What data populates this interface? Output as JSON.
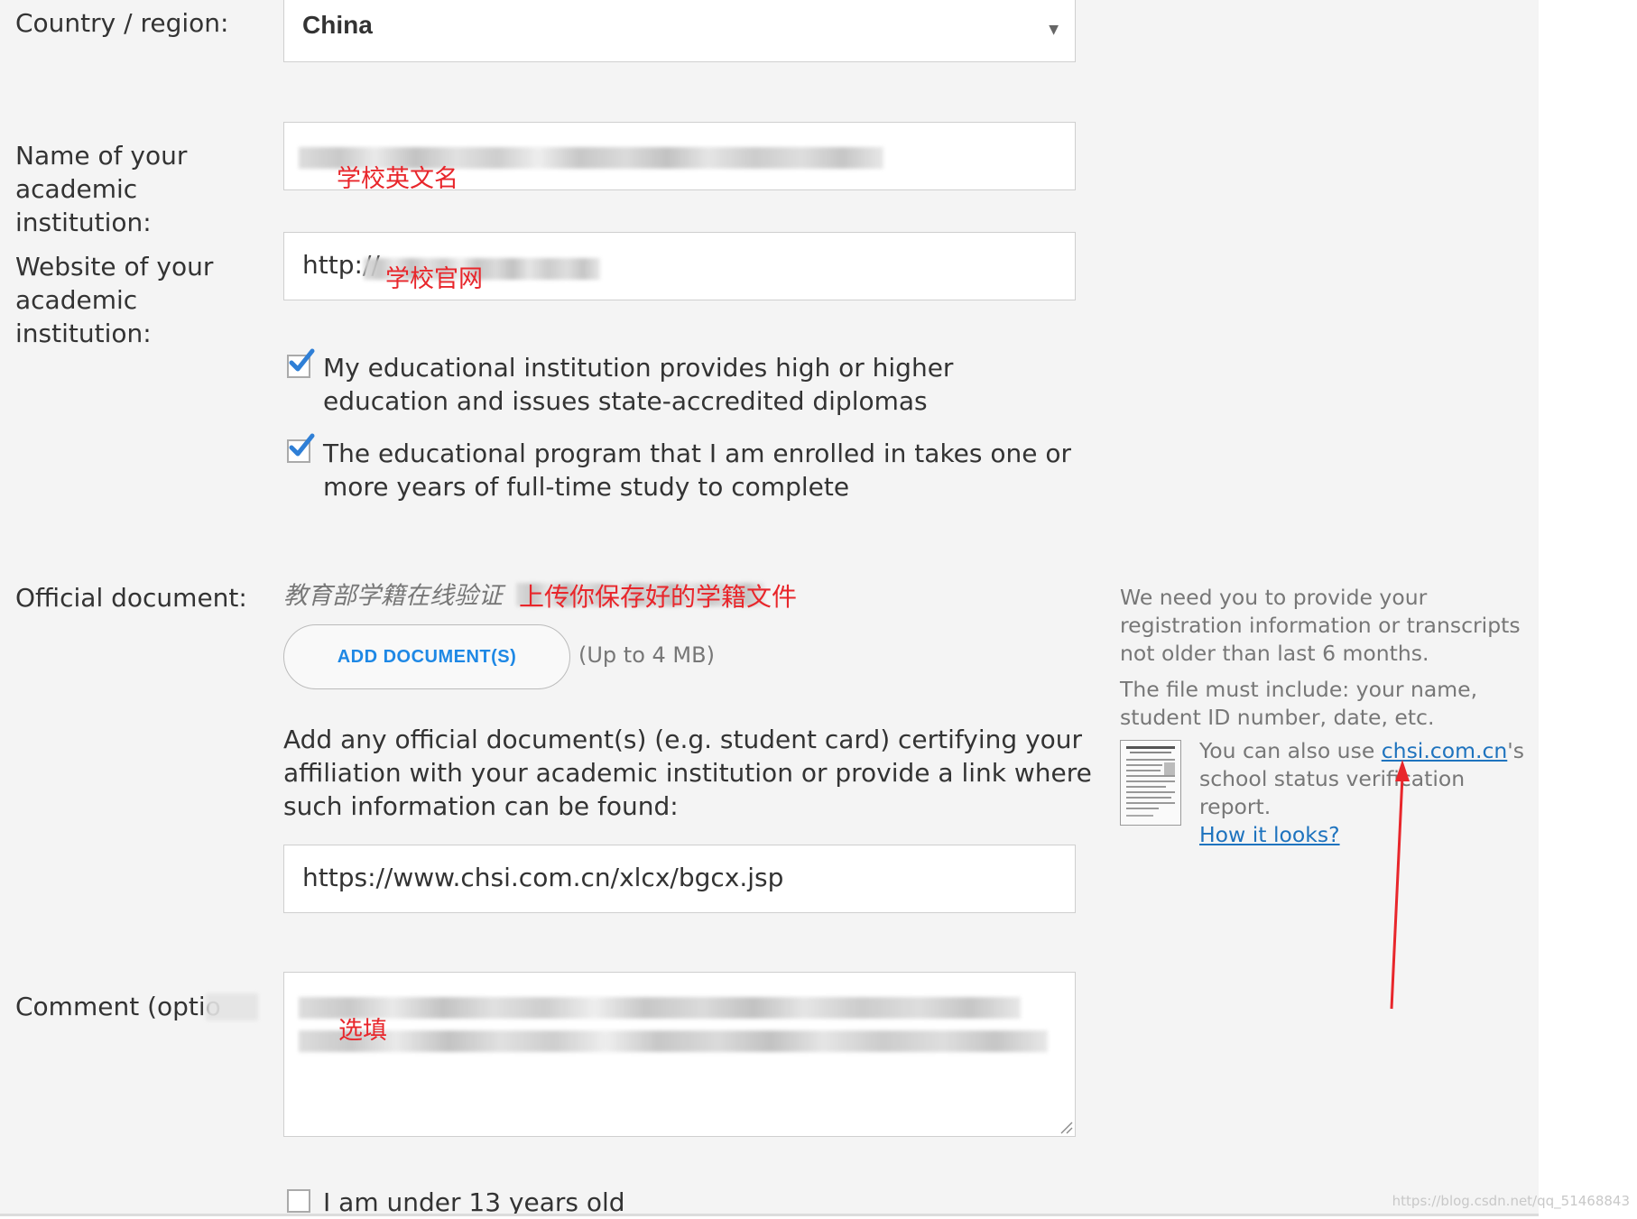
{
  "form": {
    "country_label": "Country / region:",
    "country_value": "China",
    "institution_name_label": "Name of your academic institution:",
    "institution_name_annotation": "学校英文名",
    "website_label": "Website of your academic institution:",
    "website_value": "http://",
    "website_annotation": "学校官网",
    "checkbox_1_label": "My educational institution provides high or higher education and issues state-accredited diplomas",
    "checkbox_1_checked": true,
    "checkbox_2_label": "The educational program that I am enrolled in takes one or more years of full-time study to complete",
    "checkbox_2_checked": true,
    "official_doc_label": "Official document:",
    "official_doc_filename": "教育部学籍在线验证",
    "official_doc_annotation": "上传你保存好的学籍文件",
    "add_document_button": "ADD DOCUMENT(S)",
    "size_hint": "(Up to 4 MB)",
    "link_instruction": "Add any official document(s) (e.g. student card) certifying your affiliation with your academic institution or provide a link where such information can be found:",
    "link_value": "https://www.chsi.com.cn/xlcx/bgcx.jsp",
    "comment_label": "Comment (optio",
    "comment_annotation": "选填",
    "under13_label": "I am under 13 years old",
    "under13_checked": false
  },
  "sidebar": {
    "para1": "We need you to provide your registration information or transcripts not older than last 6 months.",
    "para2": "The file must include: your name, student ID number, date, etc.",
    "note_prefix": "You can also use ",
    "note_link": "chsi.com.cn",
    "note_suffix_1": "'s",
    "note_suffix_2": "school status verification report.",
    "how_it_looks_link": "How it looks?"
  },
  "watermark": "https://blog.csdn.net/qq_51468843",
  "colors": {
    "accent_blue": "#1e88e5",
    "checkmark_blue": "#2f7fd6",
    "annotation_red": "#e8262b",
    "form_background": "#f4f4f4"
  },
  "icons": {
    "select_arrow": "caret-down",
    "checkbox": "checkmark",
    "resize": "resize-grip",
    "document_preview": "document-thumbnail",
    "annotation_arrow": "red-arrow"
  }
}
